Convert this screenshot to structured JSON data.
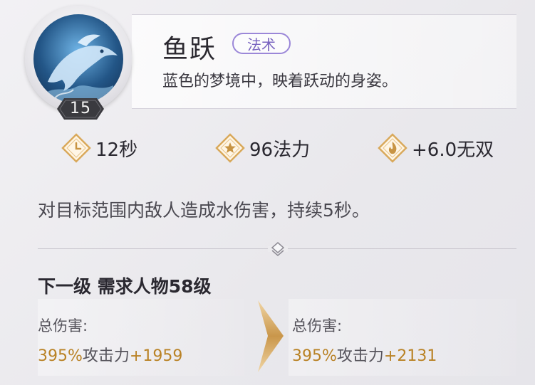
{
  "skill": {
    "name": "鱼跃",
    "tag": "法术",
    "subtitle": "蓝色的梦境中，映着跃动的身姿。",
    "level": "15",
    "icon": "dolphin-icon"
  },
  "stats": [
    {
      "icon": "clock-icon",
      "value": "12秒"
    },
    {
      "icon": "star-icon",
      "value": "96法力"
    },
    {
      "icon": "flame-icon",
      "value": "+6.0无双"
    }
  ],
  "description": "对目标范围内敌人造成水伤害，持续5秒。",
  "next_level": {
    "title": "下一级 需求人物58级",
    "current": {
      "label": "总伤害:",
      "percent": "395%",
      "mid": "攻击力",
      "plus": "+1959"
    },
    "next": {
      "label": "总伤害:",
      "percent": "395%",
      "mid": "攻击力",
      "plus": "+2131"
    }
  },
  "colors": {
    "accent_gold": "#b98225",
    "tag_purple": "#7762bf",
    "icon_gold": "#d9a95b"
  }
}
